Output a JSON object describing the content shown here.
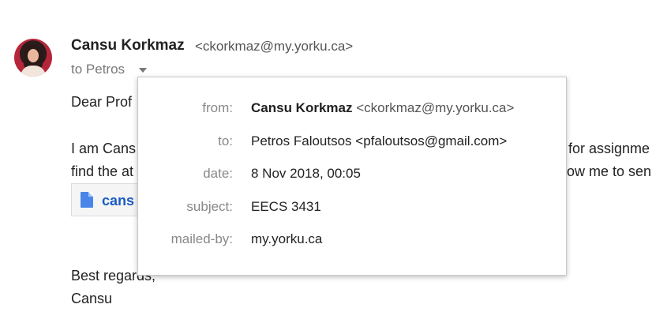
{
  "header": {
    "sender_name": "Cansu Korkmaz",
    "sender_email": "<ckorkmaz@my.yorku.ca>",
    "to_line": "to Petros"
  },
  "body": {
    "line1": "Dear Prof",
    "line2": "I am Cans",
    "line3": "find the at",
    "line2_right": "for assignme",
    "line3_right": "ow me to sen",
    "signoff": "Best regards,",
    "signature": "Cansu"
  },
  "attachment": {
    "name": "cans",
    "icon": "document-icon",
    "icon_color": "#4a86e8"
  },
  "details_popup": {
    "rows": [
      {
        "label": "from:",
        "name": "Cansu Korkmaz",
        "email": "<ckorkmaz@my.yorku.ca>"
      },
      {
        "label": "to:",
        "value": "Petros Faloutsos <pfaloutsos@gmail.com>"
      },
      {
        "label": "date:",
        "value": "8 Nov 2018, 00:05"
      },
      {
        "label": "subject:",
        "value": "EECS 3431"
      },
      {
        "label": "mailed-by:",
        "value": "my.yorku.ca"
      }
    ]
  },
  "colors": {
    "attachment_link": "#1a5bc4",
    "label_gray": "#888888"
  }
}
